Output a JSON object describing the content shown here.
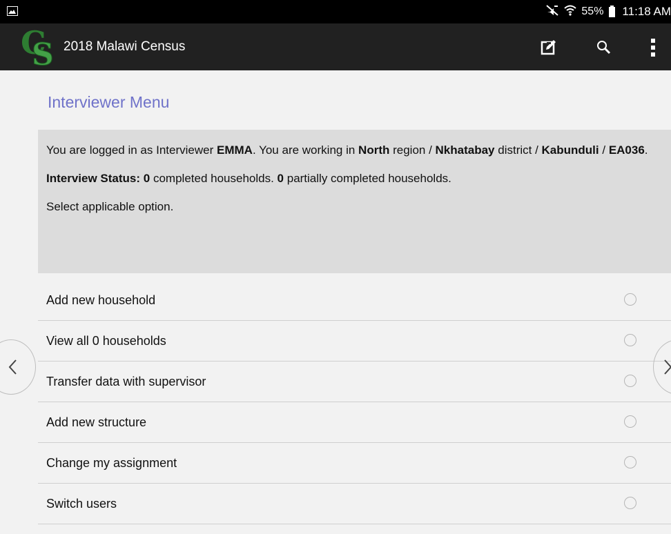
{
  "status_bar": {
    "battery_percent": "55%",
    "time": "11:18 AM",
    "icons": [
      "image-icon",
      "mute-icon",
      "wifi-icon",
      "battery-icon"
    ]
  },
  "app_bar": {
    "title": "2018 Malawi Census",
    "logo_letters": "CS",
    "logo_colors": {
      "c": "#2e7d32",
      "s": "#43a047"
    },
    "actions": [
      "edit-icon",
      "search-icon",
      "more-vert-icon"
    ]
  },
  "page": {
    "title": "Interviewer Menu",
    "title_color": "#6f72c9"
  },
  "info": {
    "line1_prefix": "You are logged in as Interviewer ",
    "interviewer": "EMMA",
    "line1_mid": ". You are working in ",
    "region": "North",
    "region_suffix": " region / ",
    "district": "Nkhatabay",
    "district_suffix": " district / ",
    "area": "Kabunduli",
    "area_sep": " / ",
    "ea": "EA036",
    "end": ".",
    "status_label": "Interview Status:",
    "completed_count": "0",
    "completed_text": " completed households. ",
    "partial_count": "0",
    "partial_text": " partially completed households.",
    "instruction": "Select applicable option."
  },
  "options": [
    {
      "label": "Add new household"
    },
    {
      "label": "View all 0 households"
    },
    {
      "label": "Transfer data with supervisor"
    },
    {
      "label": "Add new structure"
    },
    {
      "label": "Change my assignment"
    },
    {
      "label": "Switch users"
    }
  ]
}
